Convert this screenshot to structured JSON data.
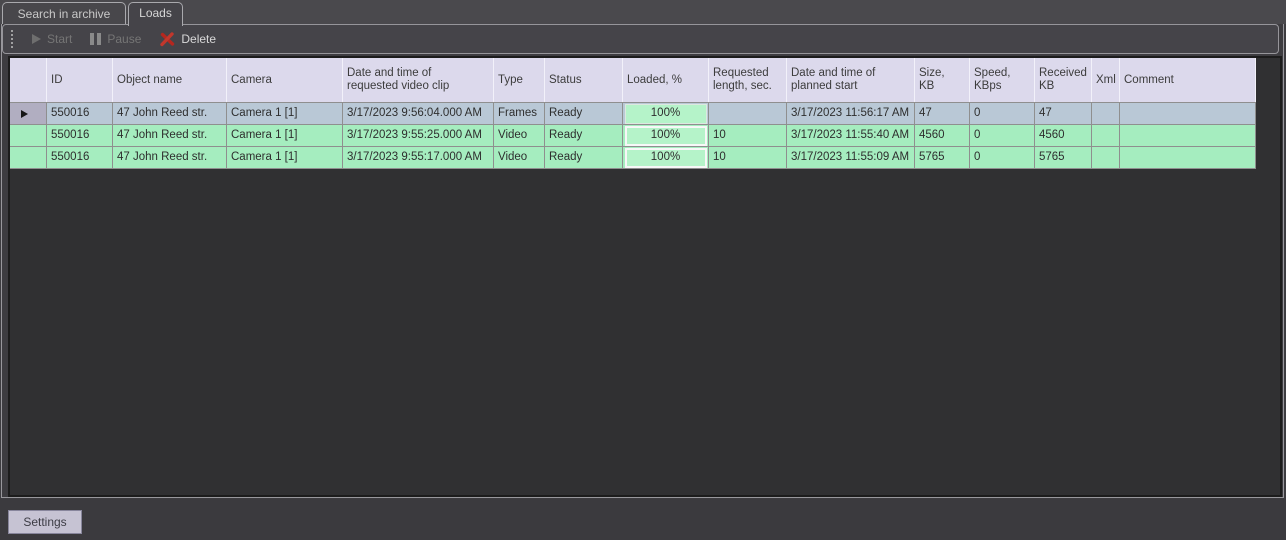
{
  "tabs": [
    {
      "label": "Search in archive"
    },
    {
      "label": "Loads"
    }
  ],
  "toolbar": {
    "start_label": "Start",
    "pause_label": "Pause",
    "delete_label": "Delete"
  },
  "grid": {
    "columns": [
      {
        "label": ""
      },
      {
        "label": "ID"
      },
      {
        "label": "Object name"
      },
      {
        "label": "Camera"
      },
      {
        "label": "Date and time of requested video clip"
      },
      {
        "label": "Type"
      },
      {
        "label": "Status"
      },
      {
        "label": "Loaded, %"
      },
      {
        "label": "Requested length, sec."
      },
      {
        "label": "Date and time of planned start"
      },
      {
        "label": "Size, KB"
      },
      {
        "label": "Speed, KBps"
      },
      {
        "label": "Received KB"
      },
      {
        "label": "Xml"
      },
      {
        "label": "Comment"
      }
    ],
    "rows": [
      {
        "id": "550016",
        "object_name": "47 John Reed str.",
        "camera": "Camera 1 [1]",
        "requested_clip_time": "3/17/2023 9:56:04.000 AM",
        "type": "Frames",
        "status": "Ready",
        "loaded_pct": "100%",
        "requested_length_sec": "",
        "planned_start": "3/17/2023 11:56:17 AM",
        "size_kb": "47",
        "speed_kbps": "0",
        "received_kb": "47",
        "xml": "",
        "comment": "",
        "selected": true
      },
      {
        "id": "550016",
        "object_name": "47 John Reed str.",
        "camera": "Camera 1 [1]",
        "requested_clip_time": "3/17/2023 9:55:25.000 AM",
        "type": "Video",
        "status": "Ready",
        "loaded_pct": "100%",
        "requested_length_sec": "10",
        "planned_start": "3/17/2023 11:55:40 AM",
        "size_kb": "4560",
        "speed_kbps": "0",
        "received_kb": "4560",
        "xml": "",
        "comment": "",
        "selected": false
      },
      {
        "id": "550016",
        "object_name": "47 John Reed str.",
        "camera": "Camera 1 [1]",
        "requested_clip_time": "3/17/2023 9:55:17.000 AM",
        "type": "Video",
        "status": "Ready",
        "loaded_pct": "100%",
        "requested_length_sec": "10",
        "planned_start": "3/17/2023 11:55:09 AM",
        "size_kb": "5765",
        "speed_kbps": "0",
        "received_kb": "5765",
        "xml": "",
        "comment": "",
        "selected": false
      }
    ]
  },
  "footer": {
    "settings_label": "Settings"
  },
  "colors": {
    "header_bg": "#dcd9ec",
    "selected_row_bg": "#b9c8d6",
    "row_bg": "#a5edbf",
    "progress_fill": "#b5f3c9",
    "delete_icon_red": "#b5271f",
    "grid_empty_bg": "#303032",
    "window_bg": "#3b3a3e"
  }
}
